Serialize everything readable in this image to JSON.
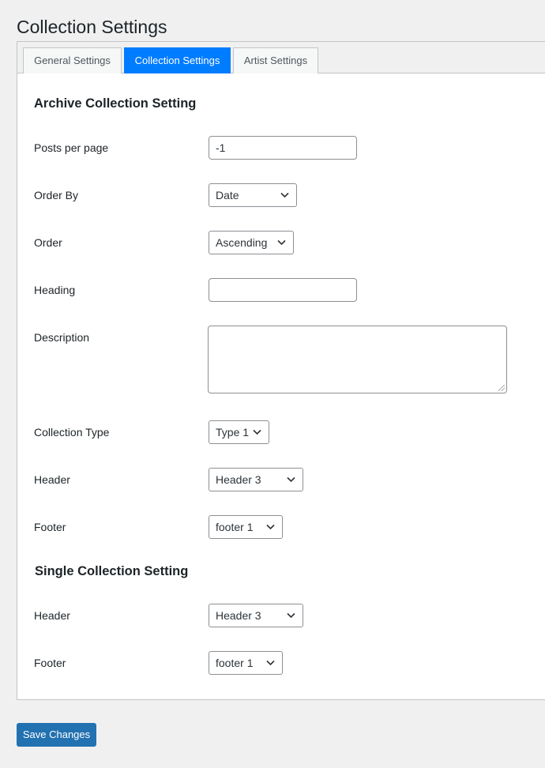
{
  "page": {
    "title": "Collection Settings"
  },
  "tabs": [
    {
      "label": "General Settings",
      "active": false
    },
    {
      "label": "Collection Settings",
      "active": true
    },
    {
      "label": "Artist Settings",
      "active": false
    }
  ],
  "archive": {
    "heading": "Archive Collection Setting",
    "posts_per_page": {
      "label": "Posts per page",
      "value": "-1"
    },
    "order_by": {
      "label": "Order By",
      "value": "Date"
    },
    "order": {
      "label": "Order",
      "value": "Ascending"
    },
    "heading_field": {
      "label": "Heading",
      "value": ""
    },
    "description": {
      "label": "Description",
      "value": ""
    },
    "collection_type": {
      "label": "Collection Type",
      "value": "Type 1"
    },
    "header": {
      "label": "Header",
      "value": "Header 3"
    },
    "footer": {
      "label": "Footer",
      "value": "footer 1"
    }
  },
  "single": {
    "heading": "Single Collection Setting",
    "header": {
      "label": "Header",
      "value": "Header 3"
    },
    "footer": {
      "label": "Footer",
      "value": "footer 1"
    }
  },
  "actions": {
    "save_label": "Save Changes"
  },
  "colors": {
    "accent": "#007cff",
    "primary_button": "#2271b1",
    "background": "#f0f0f1"
  },
  "icons": {
    "select_arrow": "chevron-down-icon"
  }
}
